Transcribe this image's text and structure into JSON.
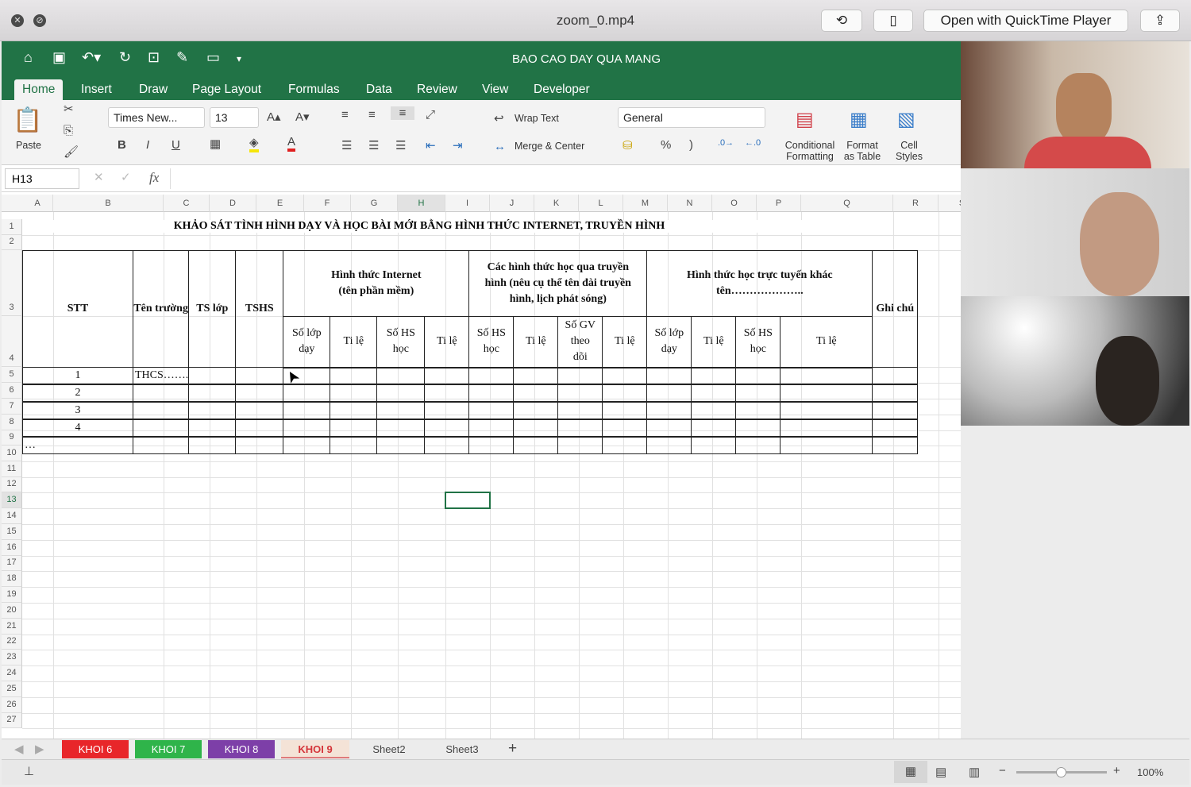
{
  "player": {
    "title": "zoom_0.mp4",
    "open_with": "Open with QuickTime Player"
  },
  "excel": {
    "doc_title": "BAO CAO DAY QUA MANG",
    "tabs": [
      "Home",
      "Insert",
      "Draw",
      "Page Layout",
      "Formulas",
      "Data",
      "Review",
      "View",
      "Developer"
    ],
    "ribbon": {
      "paste": "Paste",
      "font": "Times New...",
      "size": "13",
      "wrap": "Wrap Text",
      "merge": "Merge & Center",
      "number_format": "General",
      "conditional": [
        "Conditional",
        "Formatting"
      ],
      "format_table": [
        "Format",
        "as Table"
      ],
      "cell_styles": [
        "Cell",
        "Styles"
      ],
      "bold": "B",
      "italic": "I",
      "underline": "U",
      "percent": "%",
      "comma": ")"
    },
    "name_box": "H13",
    "fx": "fx",
    "columns": [
      "A",
      "B",
      "C",
      "D",
      "E",
      "F",
      "G",
      "H",
      "I",
      "J",
      "K",
      "L",
      "M",
      "N",
      "O",
      "P",
      "Q",
      "R",
      "S"
    ],
    "rows": [
      "1",
      "2",
      "3",
      "4",
      "5",
      "6",
      "7",
      "8",
      "9",
      "10",
      "11",
      "12",
      "13",
      "14",
      "15",
      "16",
      "17",
      "18",
      "19",
      "20",
      "21",
      "22",
      "23",
      "24",
      "25",
      "26",
      "27"
    ],
    "sheet": {
      "title": "KHẢO SÁT TÌNH HÌNH DẠY VÀ HỌC BÀI MỚI BẰNG HÌNH THỨC INTERNET, TRUYỀN HÌNH",
      "headers": {
        "stt": "STT",
        "ten_truong": "Tên trường",
        "ts_lop": "TS lớp",
        "tshs": "TSHS",
        "g1": "Hình thức Internet (tên phần mềm)",
        "g2": "Các hình thức học qua truyền hình (nêu cụ thể tên đài truyền hình, lịch phát sóng)",
        "g3": "Hình thức học trực tuyến khác tên………………..",
        "ghi_chu": "Ghi chú"
      },
      "subheaders": [
        "Số lớp dạy",
        "Ti lệ",
        "Số HS học",
        "Ti lệ",
        "Số HS học",
        "Ti lệ",
        "Số GV theo dõi",
        "Ti lệ",
        "Số lớp dạy",
        "Ti lệ",
        "Số HS học",
        "Ti lệ"
      ],
      "data_rows": [
        [
          "1",
          "THCS……."
        ],
        [
          "2",
          ""
        ],
        [
          "3",
          ""
        ],
        [
          "4",
          ""
        ],
        [
          "…",
          ""
        ]
      ]
    },
    "sheet_tabs": [
      {
        "label": "KHOI 6",
        "color": "#e8262a"
      },
      {
        "label": "KHOI 7",
        "color": "#2fb44a"
      },
      {
        "label": "KHOI 8",
        "color": "#7d3fa8"
      },
      {
        "label": "KHOI 9",
        "color": "#f4e3d7",
        "active": true
      },
      {
        "label": "Sheet2"
      },
      {
        "label": "Sheet3"
      }
    ],
    "zoom": "100%",
    "accent": "#217346"
  }
}
